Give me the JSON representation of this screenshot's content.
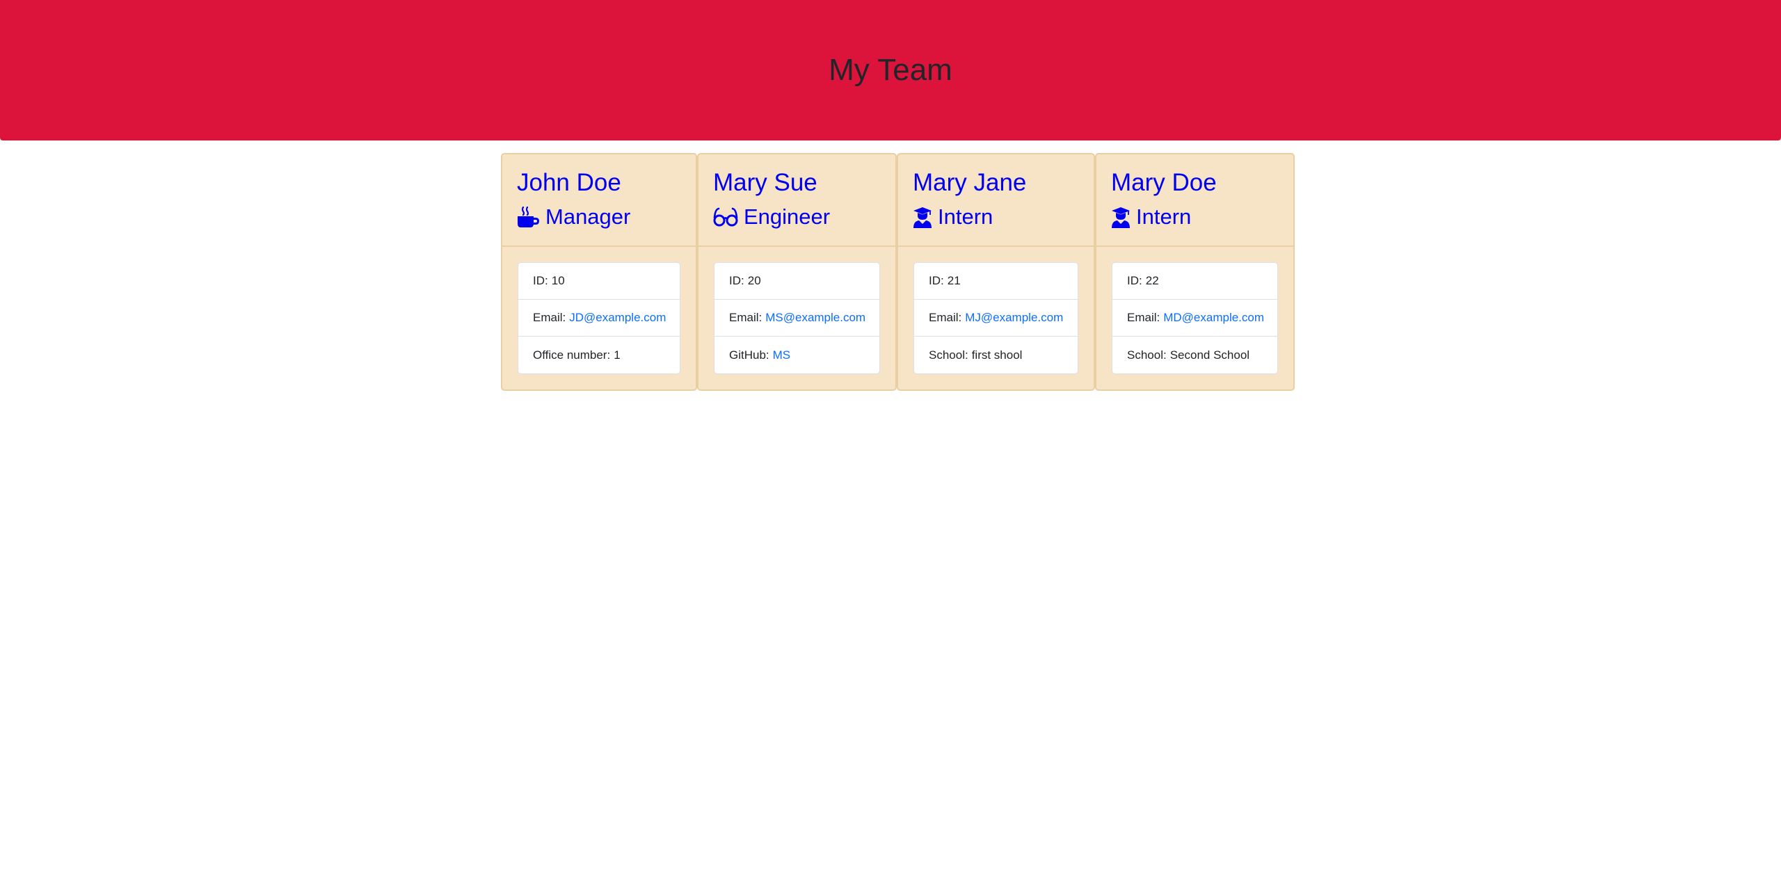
{
  "page": {
    "title": "My Team"
  },
  "colors": {
    "header_background": "#dc143c",
    "card_background": "#f7e4c7",
    "name_color": "#0000ee",
    "link_color": "#0d6efd"
  },
  "employees": [
    {
      "name": "John Doe",
      "role": "Manager",
      "icon": "coffee-mug-icon",
      "id_label": "ID:",
      "id": "10",
      "email_label": "Email:",
      "email": "JD@example.com",
      "extra_label": "Office number:",
      "extra_value": "1"
    },
    {
      "name": "Mary Sue",
      "role": "Engineer",
      "icon": "glasses-icon",
      "id_label": "ID:",
      "id": "20",
      "email_label": "Email:",
      "email": "MS@example.com",
      "extra_label": "GitHub:",
      "extra_value": "MS"
    },
    {
      "name": "Mary Jane",
      "role": "Intern",
      "icon": "graduate-icon",
      "id_label": "ID:",
      "id": "21",
      "email_label": "Email:",
      "email": "MJ@example.com",
      "extra_label": "School:",
      "extra_value": "first shool"
    },
    {
      "name": "Mary Doe",
      "role": "Intern",
      "icon": "graduate-icon",
      "id_label": "ID:",
      "id": "22",
      "email_label": "Email:",
      "email": "MD@example.com",
      "extra_label": "School:",
      "extra_value": "Second School"
    }
  ]
}
